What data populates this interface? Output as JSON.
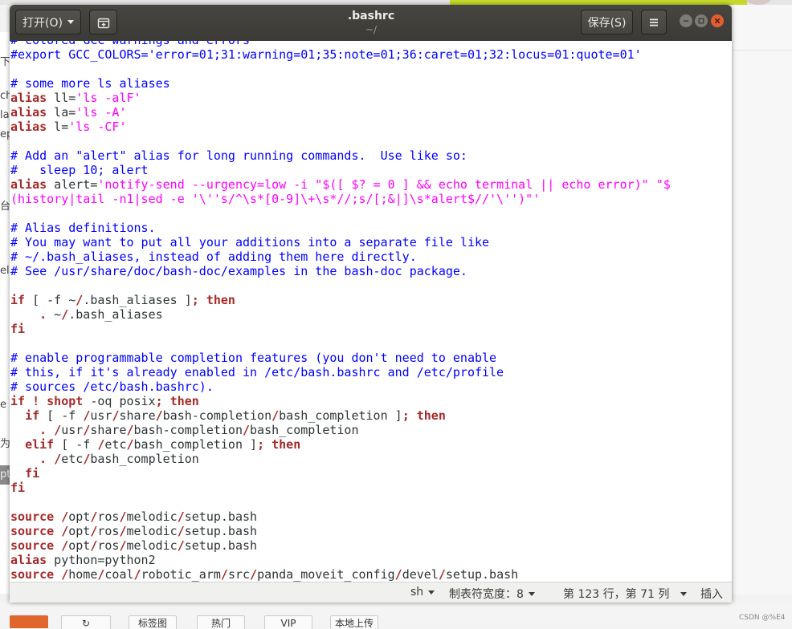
{
  "window": {
    "title": ".bashrc",
    "subtitle": "~/",
    "open_label": "打开(O)",
    "save_label": "保存(S)"
  },
  "icons": {
    "menu": "hamburger-icon",
    "new_tab": "new-tab-icon",
    "minimize": "minimize-icon",
    "maximize": "maximize-icon",
    "close": "close-icon"
  },
  "editor": {
    "lines": [
      "# colored GCC warnings and errors",
      "#export GCC_COLORS='error=01;31:warning=01;35:note=01;36:caret=01;32:locus=01:quote=01'",
      "",
      "# some more ls aliases",
      "alias ll='ls -alF'",
      "alias la='ls -A'",
      "alias l='ls -CF'",
      "",
      "# Add an \"alert\" alias for long running commands.  Use like so:",
      "#   sleep 10; alert",
      "alias alert='notify-send --urgency=low -i \"$([ $? = 0 ] && echo terminal || echo error)\" \"$",
      "(history|tail -n1|sed -e '\\''s/^\\s*[0-9]\\+\\s*//;s/[;&|]\\s*alert$//'\\'')\"'",
      "",
      "# Alias definitions.",
      "# You may want to put all your additions into a separate file like",
      "# ~/.bash_aliases, instead of adding them here directly.",
      "# See /usr/share/doc/bash-doc/examples in the bash-doc package.",
      "",
      "if [ -f ~/.bash_aliases ]; then",
      "    . ~/.bash_aliases",
      "fi",
      "",
      "# enable programmable completion features (you don't need to enable",
      "# this, if it's already enabled in /etc/bash.bashrc and /etc/profile",
      "# sources /etc/bash.bashrc).",
      "if ! shopt -oq posix; then",
      "  if [ -f /usr/share/bash-completion/bash_completion ]; then",
      "    . /usr/share/bash-completion/bash_completion",
      "  elif [ -f /etc/bash_completion ]; then",
      "    . /etc/bash_completion",
      "  fi",
      "fi",
      "",
      "source /opt/ros/melodic/setup.bash",
      "source /opt/ros/melodic/setup.bash",
      "source /opt/ros/melodic/setup.bash",
      "alias python=python2",
      "source /home/coal/robotic_arm/src/panda_moveit_config/devel/setup.bash"
    ]
  },
  "statusbar": {
    "language": "sh",
    "tab_width": "制表符宽度：8",
    "position": "第 123 行，第 71 列",
    "mode": "插入"
  },
  "background": {
    "side_fragments": [
      "下",
      "ch",
      "la",
      "ep",
      "台",
      "elt",
      "e",
      "为",
      "pt"
    ],
    "bottom_buttons": [
      "标签图",
      "热门",
      "VIP",
      "本地上传"
    ],
    "refresh_glyph": "↻",
    "watermark": "CSDN @%E4"
  }
}
